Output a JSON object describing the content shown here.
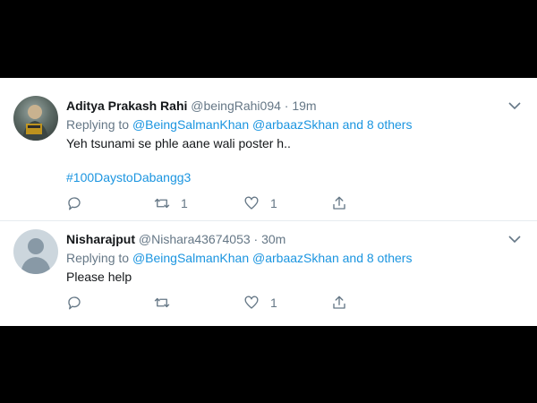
{
  "tweets": [
    {
      "author_name": "Aditya Prakash Rahi",
      "handle": "@beingRahi094",
      "separator": "·",
      "time": "19m",
      "replying_prefix": "Replying to",
      "replying_user1": "@BeingSalmanKhan",
      "replying_user2": "@arbaazSkhan",
      "replying_others": "and 8 others",
      "text": "Yeh tsunami se phle aane wali poster h..",
      "hashtag": "#100DaystoDabangg3",
      "reply_count": "",
      "retweet_count": "1",
      "like_count": "1",
      "avatar_icon": "user-photo-avatar"
    },
    {
      "author_name": "Nisharajput",
      "handle": "@Nishara43674053",
      "separator": "·",
      "time": "30m",
      "replying_prefix": "Replying to",
      "replying_user1": "@BeingSalmanKhan",
      "replying_user2": "@arbaazSkhan",
      "replying_others": "and 8 others",
      "text": "Please help",
      "reply_count": "",
      "retweet_count": "",
      "like_count": "1",
      "avatar_icon": "default-profile-avatar"
    }
  ],
  "colors": {
    "link": "#1b95e0",
    "muted": "#657786",
    "text": "#14171a",
    "letterbox": "#000000"
  },
  "icons": {
    "menu": "chevron-down-icon",
    "reply": "reply-icon",
    "retweet": "retweet-icon",
    "like": "heart-icon",
    "share": "share-icon"
  }
}
